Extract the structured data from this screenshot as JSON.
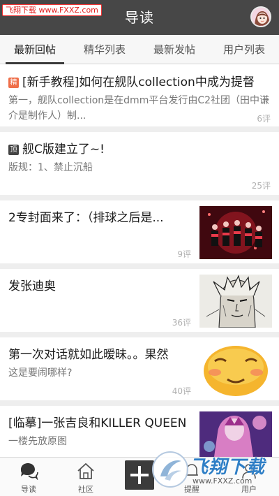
{
  "header": {
    "watermark": "飞翔下载 www.FXXZ.com",
    "title": "导读"
  },
  "tabs": [
    {
      "label": "最新回帖"
    },
    {
      "label": "精华列表"
    },
    {
      "label": "最新发帖"
    },
    {
      "label": "用户列表"
    }
  ],
  "posts": [
    {
      "badge": "精",
      "title": "[新手教程]如何在舰队collection中成为提督",
      "body": "第一，舰队collection是在dmm平台发行由C2社团（田中谦介是制作人）制...",
      "count": "6评"
    },
    {
      "badge": "顶",
      "title": "舰C版建立了~!",
      "body": "版规：1、禁止沉船",
      "count": "25评"
    },
    {
      "title": "2专封面来了：（排球之后是...",
      "count": "9评"
    },
    {
      "title": "发张迪奥",
      "count": "36评"
    },
    {
      "title": "第一次对话就如此暧昧。。果然",
      "body": "这是要闹哪样?",
      "count": "40评"
    },
    {
      "title": "[临摹]一张吉良和KILLER QUEEN",
      "body": "一楼先放原图"
    }
  ],
  "bottom_bar": {
    "items": [
      {
        "label": "导读"
      },
      {
        "label": "社区"
      },
      {
        "label": "提醒"
      },
      {
        "label": "用户"
      }
    ]
  },
  "watermark_bottom": {
    "text": "飞翔下载",
    "url": "www.FXXZ.com"
  },
  "colors": {
    "header_bg": "#474747",
    "accent_badge_jing": "#ef6f4a",
    "accent_badge_ding": "#444444",
    "watermark_blue": "#2f7fc6"
  }
}
